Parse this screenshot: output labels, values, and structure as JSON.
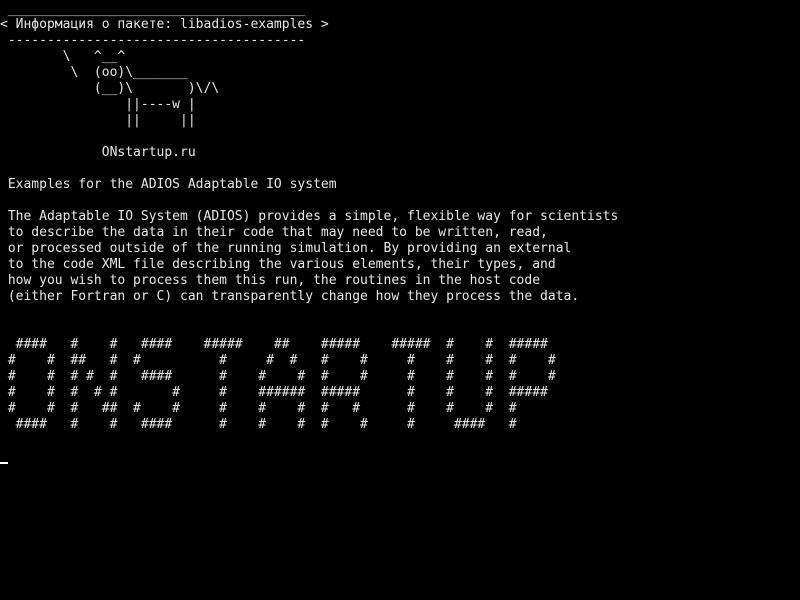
{
  "cowsay": {
    "top_border": " ______________________________________",
    "message": "< Информация о пакете: libadios-examples >",
    "bottom_border": " --------------------------------------",
    "cow": [
      "        \\   ^__^",
      "         \\  (oo)\\_______",
      "            (__)\\       )\\/\\",
      "                ||----w |",
      "                ||     ||"
    ],
    "site": "             ONstartup.ru"
  },
  "package": {
    "summary": " Examples for the ADIOS Adaptable IO system",
    "description": [
      " The Adaptable IO System (ADIOS) provides a simple, flexible way for scientists",
      " to describe the data in their code that may need to be written, read,",
      " or processed outside of the running simulation. By providing an external",
      " to the code XML file describing the various elements, their types, and",
      " how you wish to process them this run, the routines in the host code",
      " (either Fortran or C) can transparently change how they process the data."
    ]
  },
  "banner": {
    "rows": [
      "  ####   #    #   ####    #####    ##    #####    #####  #    #  #####",
      " #    #  ##   #  #          #     #  #   #    #     #    #    #  #    #",
      " #    #  # #  #   ####      #    #    #  #    #     #    #    #  #    #",
      " #    #  #  # #       #     #    ######  #####      #    #    #  #####",
      " #    #  #   ##  #    #     #    #    #  #   #      #    #    #  #",
      "  ####   #    #   ####      #    #    #  #    #     #     ####   #"
    ]
  },
  "colors": {
    "background": "#000000",
    "text": "#e8e8e8",
    "cursor": "#ffffff"
  }
}
